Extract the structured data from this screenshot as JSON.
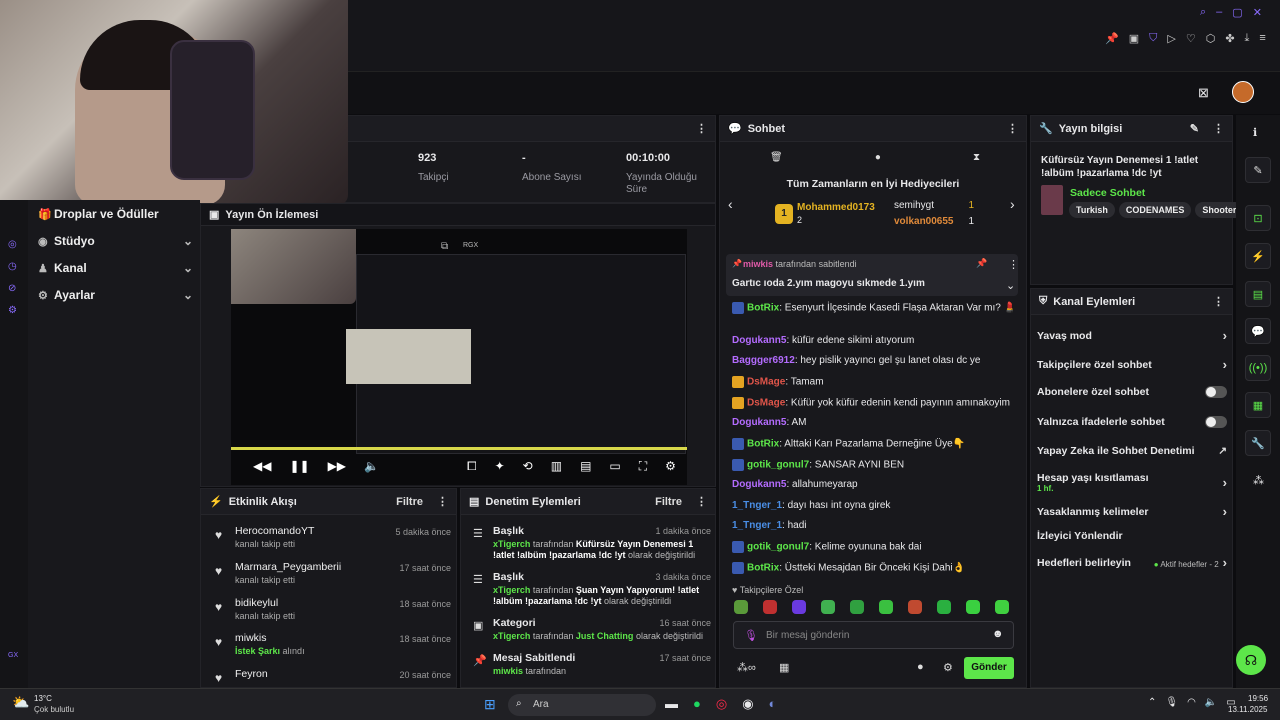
{
  "stats": [
    {
      "value": "923",
      "label": "Takipçi"
    },
    {
      "value": "-",
      "label": "Abone Sayısı"
    },
    {
      "value": "00:10:00",
      "label": "Yayında Olduğu Süre"
    }
  ],
  "nav": {
    "items": [
      {
        "label": "Droplar ve Ödüller"
      },
      {
        "label": "Stüdyo"
      },
      {
        "label": "Kanal"
      },
      {
        "label": "Ayarlar"
      }
    ],
    "rail_label": "GX"
  },
  "preview": {
    "title": "Yayın Ön İzlemesi",
    "badge": "RGX"
  },
  "activity": {
    "title": "Etkinlik Akışı",
    "filter": "Filtre",
    "items": [
      {
        "name": "HerocomandoYT",
        "sub": "kanalı takip etti",
        "time": "5 dakika önce"
      },
      {
        "name": "Marmara_Peygamberii",
        "sub": "kanalı takip etti",
        "time": "17 saat önce"
      },
      {
        "name": "bidikeylul",
        "sub": "kanalı takip etti",
        "time": "18 saat önce"
      },
      {
        "name": "miwkis",
        "sub_green": "İstek Şarkı",
        "sub": "alındı",
        "time": "18 saat önce"
      },
      {
        "name": "Feyron",
        "sub": "",
        "time": "20 saat önce"
      }
    ]
  },
  "moderation": {
    "title": "Denetim Eylemleri",
    "filter": "Filtre",
    "items": [
      {
        "title": "Başlık",
        "time": "1 dakika önce",
        "user": "xTigerch",
        "mid": "tarafından",
        "value": "Küfürsüz Yayın Denemesi 1 !atlet !albüm !pazarlama !dc !yt",
        "end": "olarak değiştirildi"
      },
      {
        "title": "Başlık",
        "time": "3 dakika önce",
        "user": "xTigerch",
        "mid": "tarafından",
        "value": "Şuan Yayın Yapıyorum! !atlet !albüm !pazarlama !dc !yt",
        "end": "olarak değiştirildi"
      },
      {
        "title": "Kategori",
        "time": "16 saat önce",
        "user": "xTigerch",
        "mid": "tarafından",
        "value": "Just Chatting",
        "end": "olarak değiştirildi"
      },
      {
        "title": "Mesaj Sabitlendi",
        "time": "17 saat önce",
        "user": "miwkis",
        "mid": "tarafından",
        "value": "",
        "end": ""
      }
    ]
  },
  "chat": {
    "title": "Sohbet",
    "gifters_title": "Tüm Zamanların en İyi Hediyecileri",
    "gifters": [
      {
        "name": "Mohammed0173",
        "count": "2"
      },
      {
        "name": "semihygt",
        "count": "1"
      },
      {
        "name": "volkan00655",
        "count": "1"
      }
    ],
    "pinned_by": "miwkis",
    "pinned_suffix": "tarafından sabitlendi",
    "pinned_text": "Gartıc ıoda 2.yım magoyu sıkmede 1.yım",
    "messages": [
      {
        "user": "BotRix",
        "color": "#5de64a",
        "text": "Esenyurt İlçesinde Kasedi Flaşa Aktaran Var mı? 💄"
      },
      {
        "user": "Dogukann5",
        "color": "#b46cff",
        "text": "küfür edene sikimi atıyorum"
      },
      {
        "user": "Baggger6912",
        "color": "#b46cff",
        "text": "hey pislik yayıncı gel şu lanet olası dc ye"
      },
      {
        "user": "DsMage",
        "color": "#e0554a",
        "text": "Tamam"
      },
      {
        "user": "DsMage",
        "color": "#e0554a",
        "text": "Küfür yok küfür edenin kendi payının amınakoyim"
      },
      {
        "user": "Dogukann5",
        "color": "#b46cff",
        "text": "AM"
      },
      {
        "user": "BotRix",
        "color": "#5de64a",
        "text": "Alttaki Karı Pazarlama Derneğine Üye👇"
      },
      {
        "user": "gotik_gonul7",
        "color": "#5de64a",
        "text": "SANSAR AYNI BEN"
      },
      {
        "user": "Dogukann5",
        "color": "#b46cff",
        "text": "allahumeyarap"
      },
      {
        "user": "1_Tnger_1",
        "color": "#4a8ee6",
        "text": "dayı hası int oyna girek"
      },
      {
        "user": "1_Tnger_1",
        "color": "#4a8ee6",
        "text": "hadi"
      },
      {
        "user": "gotik_gonul7",
        "color": "#5de64a",
        "text": "Kelime oyununa bak dai"
      },
      {
        "user": "BotRix",
        "color": "#5de64a",
        "text": "Üstteki Mesajdan Bir Önceki Kişi Dahi👌"
      }
    ],
    "emotes_label": "Takipçilere Özel",
    "input_placeholder": "Bir mesaj gönderin",
    "send_label": "Gönder"
  },
  "info": {
    "title": "Yayın bilgisi",
    "stream_title": "Küfürsüz Yayın Denemesi 1 !atlet !albüm !pazarlama !dc !yt",
    "category": "Sadece Sohbet",
    "tags": [
      "Turkish",
      "CODENAMES",
      "Shooter"
    ]
  },
  "actions": {
    "title": "Kanal Eylemleri",
    "items": [
      {
        "label": "Yavaş mod",
        "kind": "chevron"
      },
      {
        "label": "Takipçilere özel sohbet",
        "kind": "chevron"
      },
      {
        "label": "Abonelere özel sohbet",
        "kind": "toggle"
      },
      {
        "label": "Yalnızca ifadelerle sohbet",
        "kind": "toggle"
      },
      {
        "label": "Yapay Zeka ile Sohbet Denetimi",
        "kind": "link"
      },
      {
        "label": "Hesap yaşı kısıtlaması",
        "sub": "1 hf.",
        "kind": "chevron"
      },
      {
        "label": "Yasaklanmış kelimeler",
        "kind": "chevron"
      },
      {
        "label": "İzleyici Yönlendir",
        "kind": "none"
      },
      {
        "label": "Hedefleri belirleyin",
        "extra": "Aktif hedefler - 2",
        "kind": "chevron"
      }
    ]
  },
  "taskbar": {
    "temp": "13°C",
    "weather": "Çok bulutlu",
    "search": "Ara",
    "time": "19:56",
    "date": "13.11.2025"
  },
  "colors": {
    "accent": "#5de64a",
    "bg": "#0c0c0f"
  }
}
